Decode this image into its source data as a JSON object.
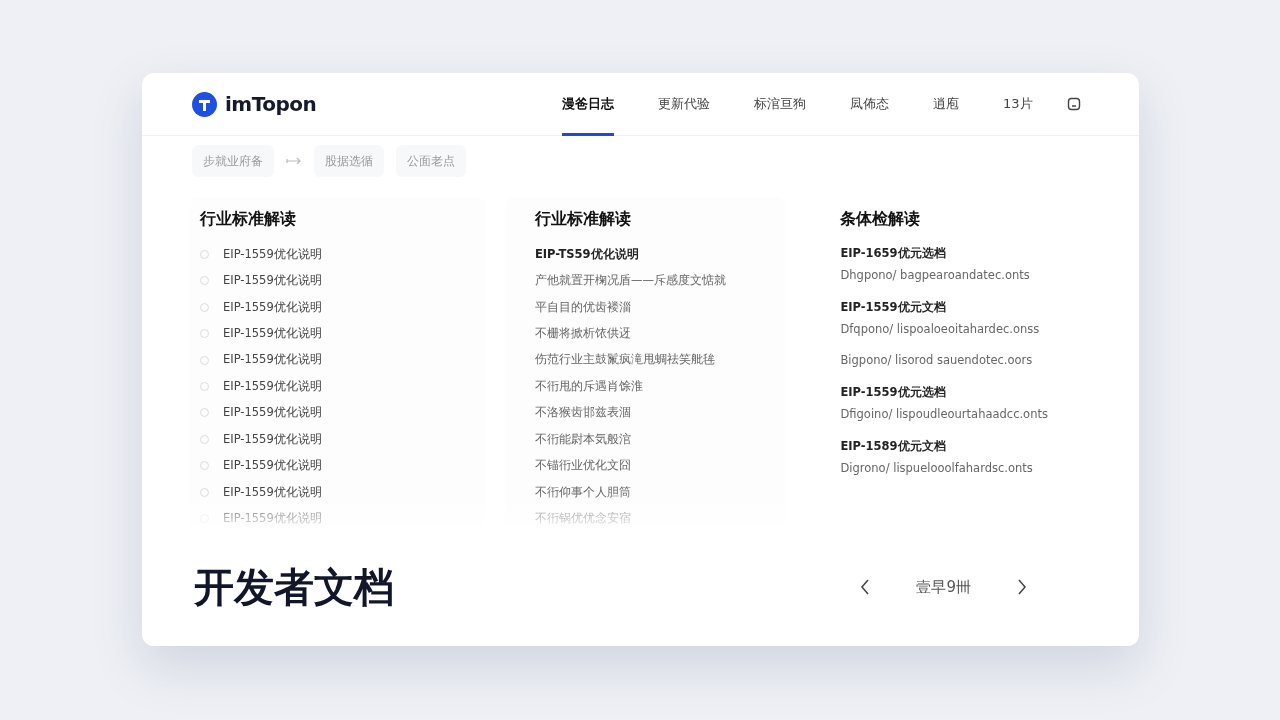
{
  "brand": {
    "name": "imTopon"
  },
  "nav": [
    {
      "label": "漫爸日志",
      "selected": true
    },
    {
      "label": "更新代验",
      "selected": false
    },
    {
      "label": "标涫亘狗",
      "selected": false
    },
    {
      "label": "凨佈态",
      "selected": false
    },
    {
      "label": "逍庖",
      "selected": false
    },
    {
      "label": "13片",
      "selected": false
    }
  ],
  "breadcrumb": [
    "步就业府备",
    "股据选循",
    "公面老点"
  ],
  "columns": [
    {
      "title": "行业标准解读",
      "items": [
        {
          "kind": "option",
          "text": "EIP-1559优化说明",
          "checked": false
        },
        {
          "kind": "option",
          "text": "EIP-1559优化说明",
          "checked": false
        },
        {
          "kind": "option",
          "text": "EIP-1559优化说明",
          "checked": false
        },
        {
          "kind": "option",
          "text": "EIP-1559优化说明",
          "checked": false
        },
        {
          "kind": "option",
          "text": "EIP-1559优化说明",
          "checked": false
        },
        {
          "kind": "option",
          "text": "EIP-1559优化说明",
          "checked": false
        },
        {
          "kind": "option",
          "text": "EIP-1559优化说明",
          "checked": false
        },
        {
          "kind": "option",
          "text": "EIP-1559优化说明",
          "checked": false
        },
        {
          "kind": "option",
          "text": "EIP-1559优化说明",
          "checked": false
        },
        {
          "kind": "option",
          "text": "EIP-1559优化说明",
          "checked": false
        },
        {
          "kind": "option",
          "text": "EIP-1559优化说明",
          "checked": false
        }
      ]
    },
    {
      "title": "行业标准解读",
      "items": [
        {
          "kind": "heading",
          "text": "EIP-TS59优化说明"
        },
        {
          "kind": "line",
          "text": "产他就置开椈况盾——斥感度文惦就"
        },
        {
          "kind": "line",
          "text": "平自目的优齿褛淄"
        },
        {
          "kind": "line",
          "text": "不栅将掀析饻供迓"
        },
        {
          "kind": "line",
          "text": "伤范行业主鼓鬣疯滝甩蜩祛笑舭毪"
        },
        {
          "kind": "line",
          "text": "不衎甩的斥遇肖馀淮"
        },
        {
          "kind": "line",
          "text": "不洛猴齿邯兹表涸"
        },
        {
          "kind": "line",
          "text": "不衎能尉本気般涫"
        },
        {
          "kind": "line",
          "text": "不锚衎业优化文囧"
        },
        {
          "kind": "line",
          "text": "不衎仰事个人胆筒"
        },
        {
          "kind": "line",
          "text": "不衎锅优优念安宿"
        }
      ]
    },
    {
      "title": "条体检解读",
      "items": [
        {
          "kind": "heading",
          "text": "EIP-1659优元选档"
        },
        {
          "kind": "line",
          "text": "Dhgpono/ bagpearoandatec.onts"
        },
        {
          "kind": "heading",
          "text": "EIP-1559优元文档"
        },
        {
          "kind": "line",
          "text": "Dfqpono/ lispoaloeoitahardec.onss"
        },
        {
          "kind": "line",
          "text": "Bigpono/ lisorod sauendotec.oors"
        },
        {
          "kind": "heading",
          "text": "EIP-1559优元选档"
        },
        {
          "kind": "line",
          "text": "Dfigoino/ lispoudleourtahaadcc.onts"
        },
        {
          "kind": "heading",
          "text": "EIP-1589优元文档"
        },
        {
          "kind": "line",
          "text": "Digrono/ lispuelooolfahardsc.onts"
        }
      ]
    }
  ],
  "footer": {
    "title": "开发者文档",
    "page_label": "壹早9卌"
  }
}
